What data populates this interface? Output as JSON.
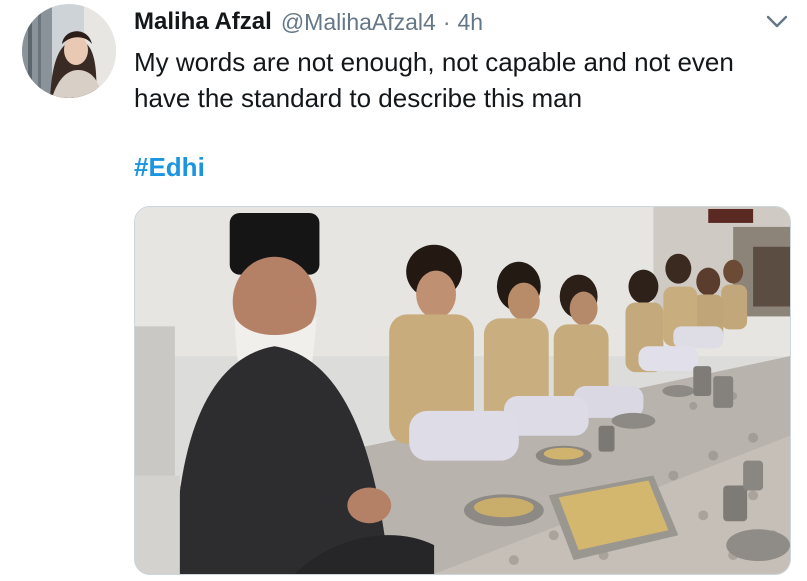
{
  "tweet": {
    "author": {
      "display_name": "Maliha Afzal",
      "handle": "@MalihaAfzal4",
      "avatar_icon": "profile-photo"
    },
    "separator": "·",
    "time": "4h",
    "text": "My words are not enough, not capable and not even have the standard to describe this man",
    "hashtag": "#Edhi",
    "menu_icon": "chevron-down-icon",
    "media": {
      "type": "photo"
    }
  },
  "colors": {
    "text_primary": "#14171a",
    "text_secondary": "#657786",
    "link": "#1b95e0",
    "border": "#ccd6dd"
  }
}
